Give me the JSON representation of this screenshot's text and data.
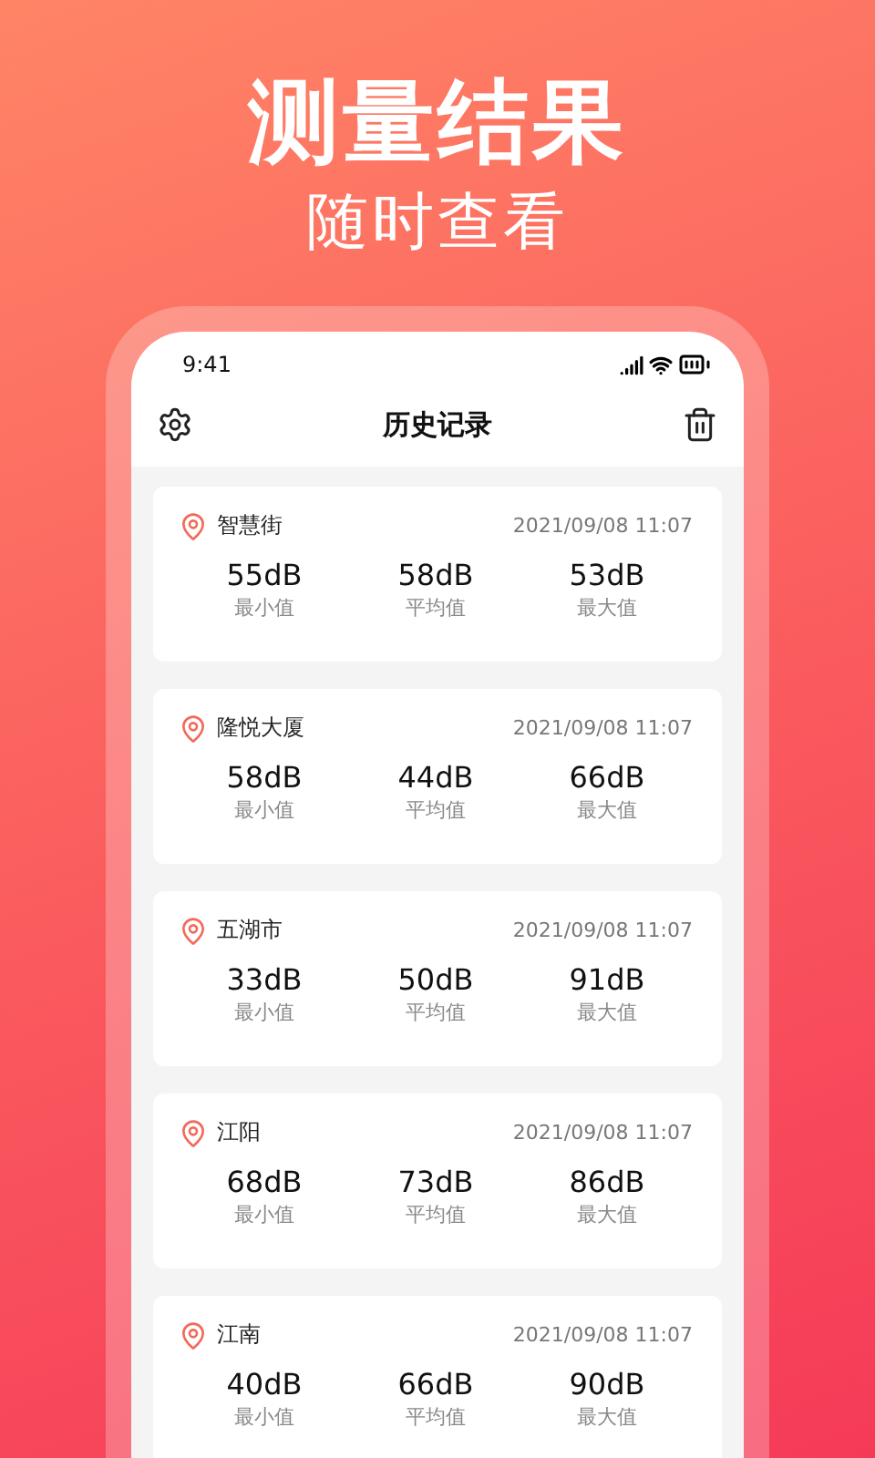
{
  "headline": "测量结果",
  "subheadline": "随时查看",
  "status_bar": {
    "time": "9:41"
  },
  "header": {
    "title": "历史记录"
  },
  "records": [
    {
      "location": "智慧街",
      "time": "2021/09/08 11:07",
      "stats": [
        {
          "value": "55dB",
          "label": "最小值"
        },
        {
          "value": "58dB",
          "label": "平均值"
        },
        {
          "value": "53dB",
          "label": "最大值"
        }
      ]
    },
    {
      "location": "隆悦大厦",
      "time": "2021/09/08 11:07",
      "stats": [
        {
          "value": "58dB",
          "label": "最小值"
        },
        {
          "value": "44dB",
          "label": "平均值"
        },
        {
          "value": "66dB",
          "label": "最大值"
        }
      ]
    },
    {
      "location": "五湖市",
      "time": "2021/09/08 11:07",
      "stats": [
        {
          "value": "33dB",
          "label": "最小值"
        },
        {
          "value": "50dB",
          "label": "平均值"
        },
        {
          "value": "91dB",
          "label": "最大值"
        }
      ]
    },
    {
      "location": "江阳",
      "time": "2021/09/08 11:07",
      "stats": [
        {
          "value": "68dB",
          "label": "最小值"
        },
        {
          "value": "73dB",
          "label": "平均值"
        },
        {
          "value": "86dB",
          "label": "最大值"
        }
      ]
    },
    {
      "location": "江南",
      "time": "2021/09/08 11:07",
      "stats": [
        {
          "value": "40dB",
          "label": "最小值"
        },
        {
          "value": "66dB",
          "label": "平均值"
        },
        {
          "value": "90dB",
          "label": "最大值"
        }
      ]
    }
  ]
}
